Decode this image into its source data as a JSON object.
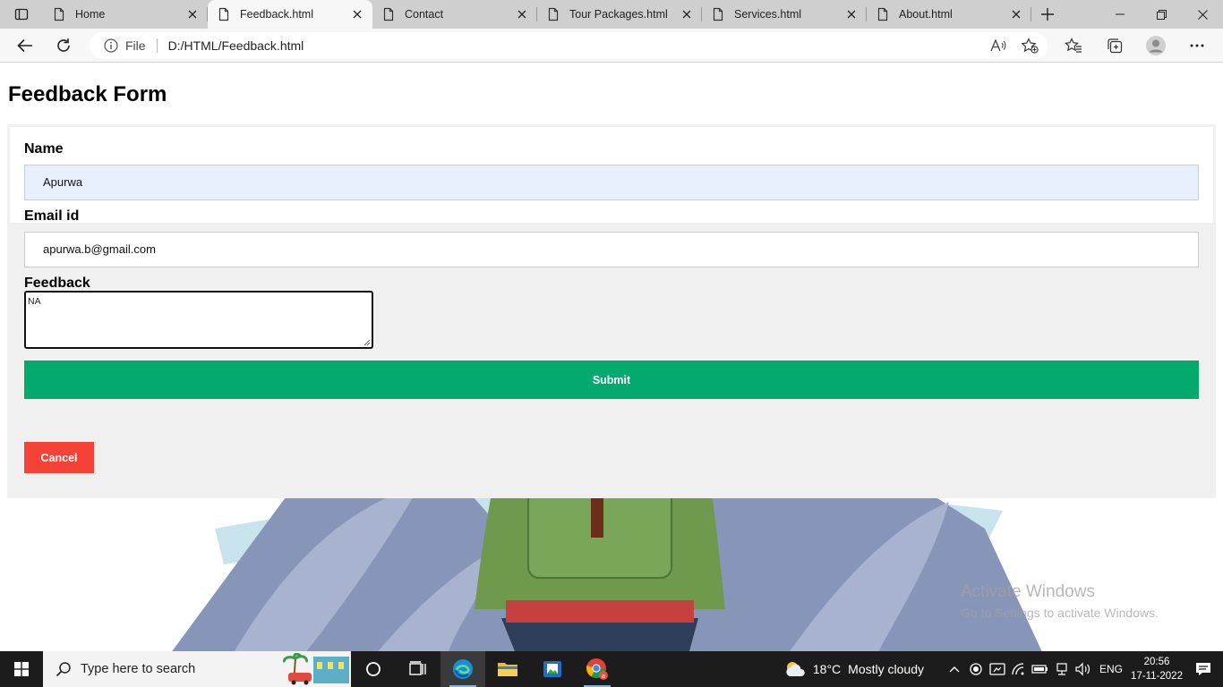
{
  "browser": {
    "tabs": [
      {
        "title": "Home",
        "active": false
      },
      {
        "title": "Feedback.html",
        "active": true
      },
      {
        "title": "Contact",
        "active": false
      },
      {
        "title": "Tour Packages.html",
        "active": false
      },
      {
        "title": "Services.html",
        "active": false
      },
      {
        "title": "About.html",
        "active": false
      }
    ],
    "address": {
      "scheme_label": "File",
      "url": "D:/HTML/Feedback.html"
    }
  },
  "page": {
    "title": "Feedback Form",
    "form": {
      "name_label": "Name",
      "name_value": "Apurwa",
      "email_label": "Email id",
      "email_value": "apurwa.b@gmail.com",
      "feedback_label": "Feedback",
      "feedback_value": "NA",
      "submit_label": "Submit",
      "cancel_label": "Cancel"
    },
    "colors": {
      "submit": "#04aa6d",
      "cancel": "#f44336",
      "autofill": "#e8f0fe"
    }
  },
  "watermark": {
    "line1": "Activate Windows",
    "line2": "Go to Settings to activate Windows."
  },
  "taskbar": {
    "search_placeholder": "Type here to search",
    "weather_temp": "18°C",
    "weather_condition": "Mostly cloudy",
    "language": "ENG",
    "time": "20:56",
    "date": "17-11-2022"
  }
}
